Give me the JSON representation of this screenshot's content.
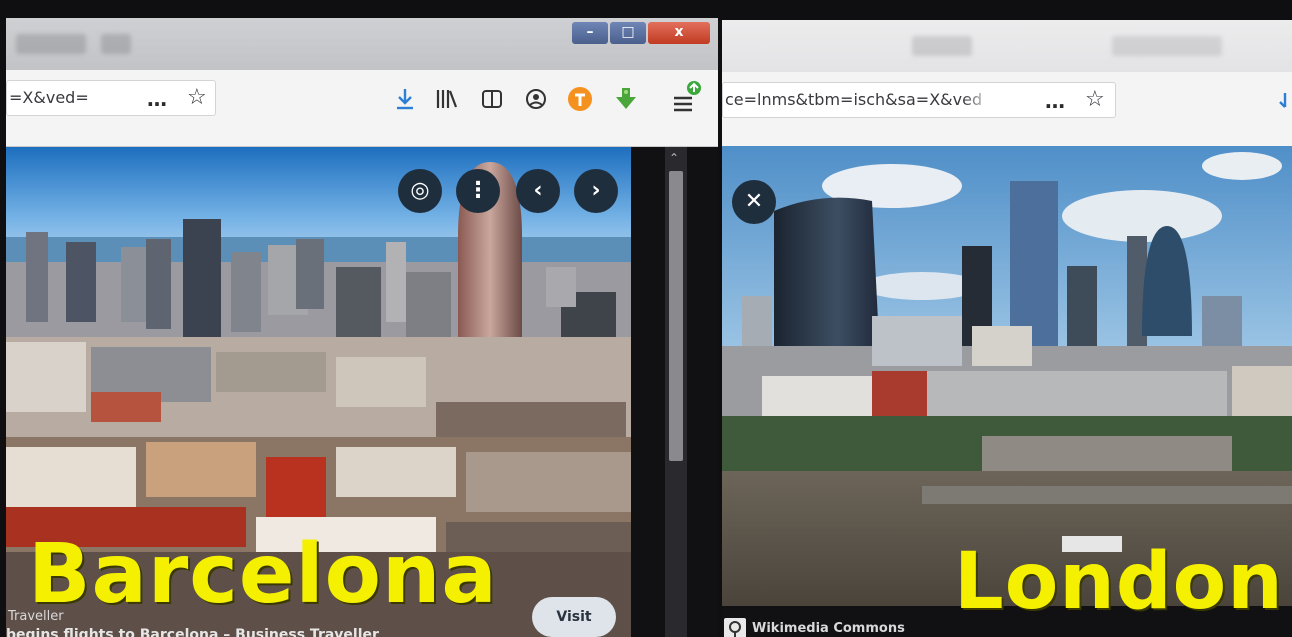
{
  "left_window": {
    "url_fragment": "=X&ved=",
    "more_icon": "…",
    "star_icon": "☆",
    "window_controls": [
      "–",
      "□",
      "x"
    ],
    "overlay_icons": [
      "lens-icon",
      "more-vertical-icon",
      "chevron-left-icon",
      "chevron-right-icon"
    ],
    "overlay_glyphs": {
      "lens": "◎",
      "more": "⋮",
      "prev": "‹",
      "next": "›"
    },
    "image_label": "Barcelona",
    "source_text": "Traveller",
    "caption": "begins flights to Barcelona – Business Traveller",
    "visit_label": "Visit",
    "accent": "#f5f000"
  },
  "right_window": {
    "url_fragment": "ce=lnms&tbm=isch&sa=X&ved",
    "more_icon": "…",
    "star_icon": "☆",
    "close_glyph": "✕",
    "image_label": "London",
    "source_text": "Wikimedia Commons"
  }
}
